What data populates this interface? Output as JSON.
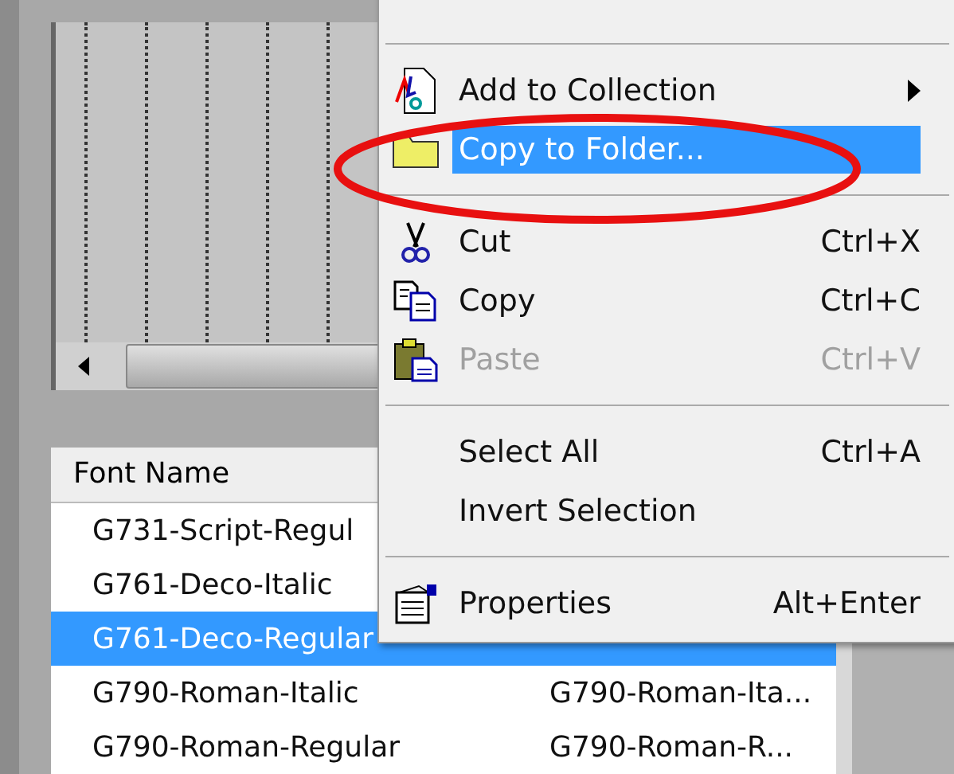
{
  "list": {
    "columns": [
      "Font Name"
    ],
    "rows": [
      {
        "name": "G731-Script-Regul",
        "selected": false
      },
      {
        "name": "G761-Deco-Italic",
        "selected": false
      },
      {
        "name": "G761-Deco-Regular",
        "selected": true
      },
      {
        "name": "G790-Roman-Italic",
        "column_2": "G790-Roman-Ita...",
        "selected": false
      },
      {
        "name": "G790-Roman-Regular",
        "column_2": "G790-Roman-R...",
        "selected": false
      }
    ]
  },
  "context_menu": {
    "items": [
      {
        "kind": "separator"
      },
      {
        "kind": "item",
        "label": "Add to Collection",
        "submenu": true,
        "selected": false,
        "disabled": false
      },
      {
        "kind": "item",
        "label": "Copy to Folder...",
        "selected": true,
        "disabled": false
      },
      {
        "kind": "separator"
      },
      {
        "kind": "item",
        "label": "Cut",
        "shortcut": "Ctrl+X",
        "selected": false,
        "disabled": false
      },
      {
        "kind": "item",
        "label": "Copy",
        "shortcut": "Ctrl+C",
        "selected": false,
        "disabled": false
      },
      {
        "kind": "item",
        "label": "Paste",
        "shortcut": "Ctrl+V",
        "selected": false,
        "disabled": true
      },
      {
        "kind": "separator"
      },
      {
        "kind": "item",
        "label": "Select All",
        "shortcut": "Ctrl+A",
        "selected": false,
        "disabled": false
      },
      {
        "kind": "item",
        "label": "Invert Selection",
        "selected": false,
        "disabled": false
      },
      {
        "kind": "separator"
      },
      {
        "kind": "item",
        "label": "Properties",
        "shortcut": "Alt+Enter",
        "selected": false,
        "disabled": false
      }
    ]
  }
}
